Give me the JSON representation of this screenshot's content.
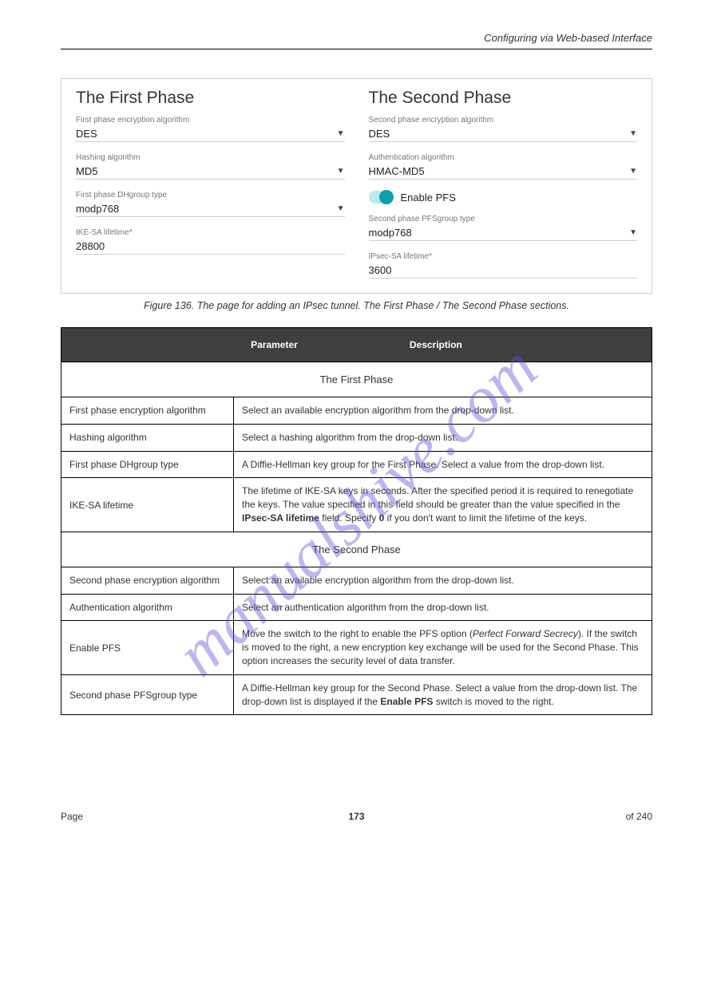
{
  "header": {
    "left": "",
    "right": "Configuring via Web-based Interface"
  },
  "figure": {
    "left_title": "The First Phase",
    "right_title": "The Second Phase",
    "f1_label": "First phase encryption algorithm",
    "f1_value": "DES",
    "f2_label": "Hashing algorithm",
    "f2_value": "MD5",
    "f3_label": "First phase DHgroup type",
    "f3_value": "modp768",
    "f4_label": "IKE-SA lifetime*",
    "f4_value": "28800",
    "s1_label": "Second phase encryption algorithm",
    "s1_value": "DES",
    "s2_label": "Authentication algorithm",
    "s2_value": "HMAC-MD5",
    "toggle_label": "Enable PFS",
    "s3_label": "Second phase PFSgroup type",
    "s3_value": "modp768",
    "s4_label": "IPsec-SA lifetime*",
    "s4_value": "3600"
  },
  "caption": "Figure 136. The page for adding an IPsec tunnel. The First Phase / The Second Phase sections.",
  "table": {
    "bar_title": "Parameter",
    "bar_desc": "Description",
    "section1": "The First Phase",
    "r1p": "First phase encryption algorithm",
    "r1d": "Select an available encryption algorithm from the drop-down list.",
    "row1v": "",
    "r2p": "Hashing algorithm",
    "r2d": "Select a hashing algorithm from the drop-down list.",
    "r3p": "First phase DHgroup type",
    "r3d1": "A Diffie-Hellman key group for the First Phase. Select a value from the drop-down list.",
    "r4p": "IKE-SA lifetime",
    "r4d1": "The lifetime of IKE-SA keys in seconds. After the specified period it is required to renegotiate the keys. The value specified in this field should be greater than the value specified in the ",
    "r4d2": "IPsec-SA lifetime",
    "r4d3": " field. Specify ",
    "r4d4": "0",
    "r4d5": " if you don't want to limit the lifetime of the keys.",
    "section2": "The Second Phase",
    "r5p": "Second phase encryption algorithm",
    "r5d": "Select an available encryption algorithm from the drop-down list.",
    "r6p": "Authentication algorithm",
    "r6d": "Select an authentication algorithm from the drop-down list.",
    "r7p": "Enable PFS",
    "r7d1": "Move the switch to the right to enable the PFS option (",
    "r7d2": "Perfect Forward Secrecy",
    "r7d3": "). If the switch is moved to the right, a new encryption key exchange will be used for the Second Phase. This option increases the security level of data transfer.",
    "r8p": "Second phase PFSgroup type",
    "r8d1": "A Diffie-Hellman key group for the Second Phase. Select a value from the drop-down list. The drop-down list is displayed if the ",
    "r8d2": "Enable PFS",
    "r8d3": " switch is moved to the right."
  },
  "footer": {
    "left": "Page",
    "mid": "173",
    "right": "of 240"
  },
  "watermark": "manualshive.com"
}
